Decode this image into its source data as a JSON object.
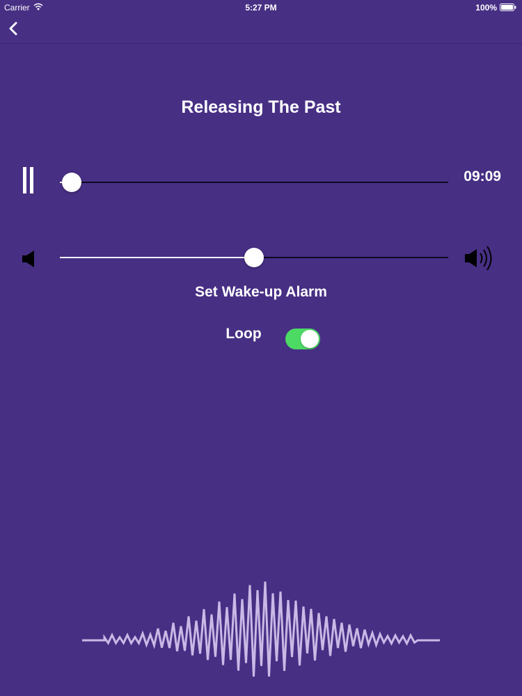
{
  "status_bar": {
    "carrier": "Carrier",
    "time": "5:27 PM",
    "battery": "100%"
  },
  "nav": {
    "back_icon": "chevron-left-icon"
  },
  "player": {
    "title": "Releasing The Past",
    "time_remaining": "09:09",
    "progress_fraction": 0.03,
    "volume_fraction": 0.5,
    "pause_icon": "pause-icon",
    "volume_low_icon": "speaker-low-icon",
    "volume_high_icon": "speaker-high-icon"
  },
  "options": {
    "alarm_label": "Set Wake-up Alarm",
    "loop_label": "Loop",
    "loop_on": true
  },
  "colors": {
    "background": "#472f84",
    "toggle_on": "#4cd964",
    "waveform": "#c9b9e6",
    "track_inactive": "#0d0a22"
  },
  "waveform_icon": "audio-waveform"
}
